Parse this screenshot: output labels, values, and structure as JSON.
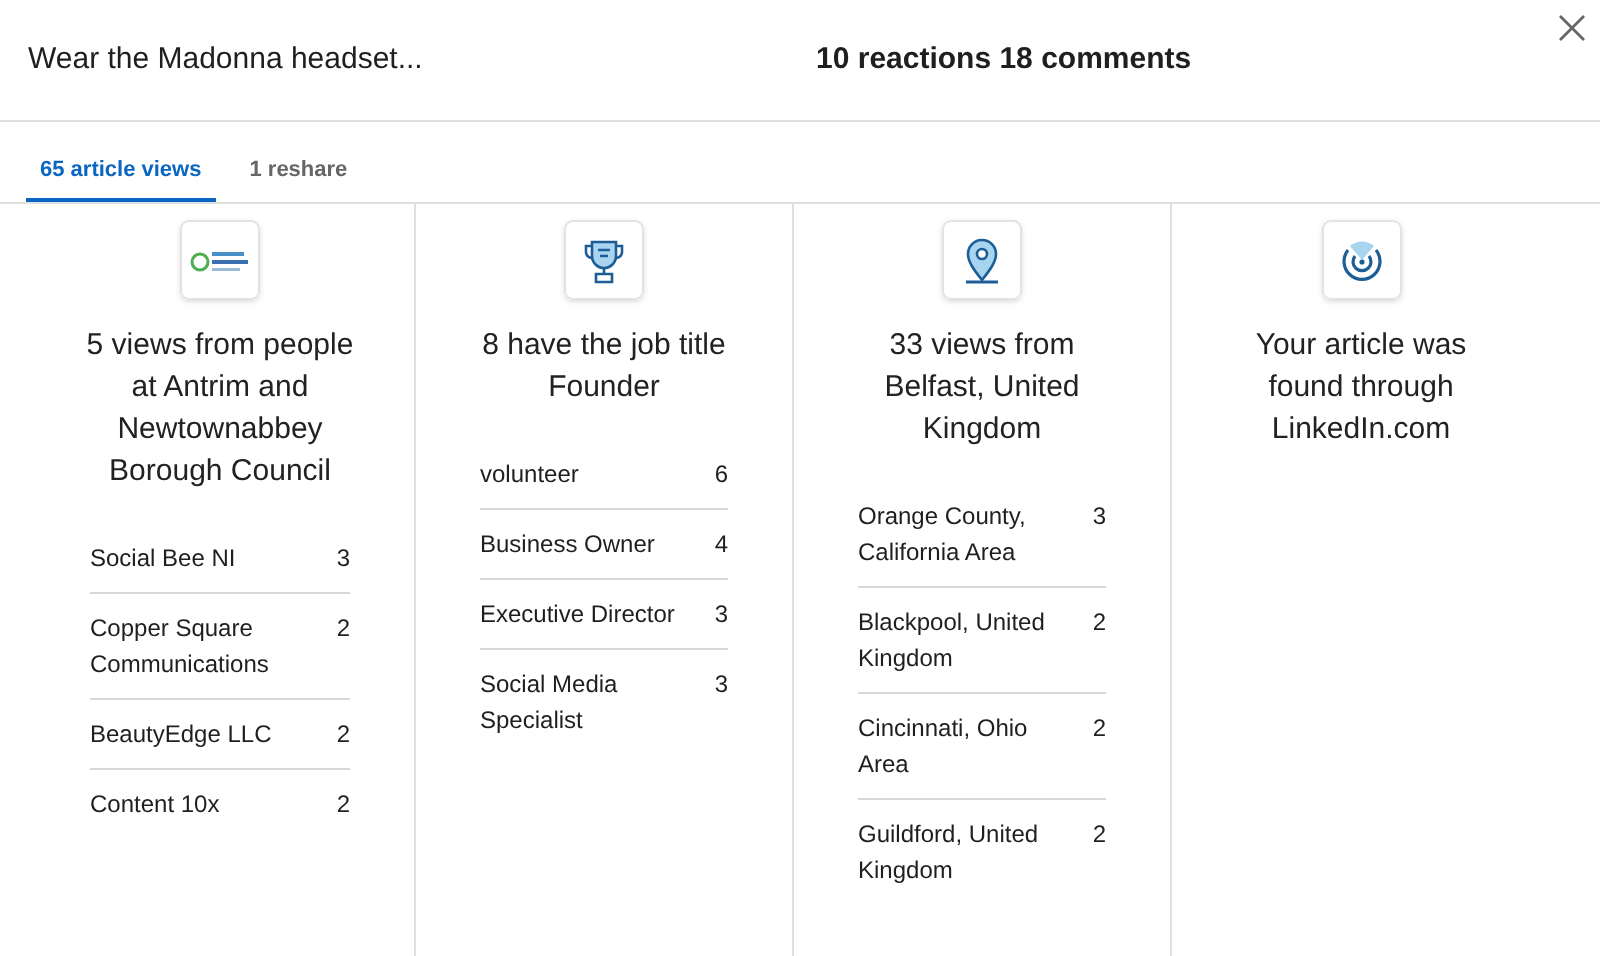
{
  "header": {
    "title": "Wear the Madonna headset...",
    "summary": "10 reactions 18 comments"
  },
  "tabs": [
    {
      "label": "65 article views",
      "selected": true
    },
    {
      "label": "1 reshare",
      "selected": false
    }
  ],
  "columns": [
    {
      "kind": "logo",
      "heading": "5 views from people at Antrim and Newtownabbey Borough Council",
      "rows": [
        {
          "label": "Social Bee NI",
          "count": "3"
        },
        {
          "label": "Copper Square Communications",
          "count": "2"
        },
        {
          "label": "BeautyEdge LLC",
          "count": "2"
        },
        {
          "label": "Content 10x",
          "count": "2"
        }
      ]
    },
    {
      "kind": "trophy",
      "heading": "8 have the job title Founder",
      "rows": [
        {
          "label": "volunteer",
          "count": "6"
        },
        {
          "label": "Business Owner",
          "count": "4"
        },
        {
          "label": "Executive Director",
          "count": "3"
        },
        {
          "label": "Social Media Specialist",
          "count": "3"
        }
      ]
    },
    {
      "kind": "pin",
      "heading": "33 views from Belfast, United Kingdom",
      "rows": [
        {
          "label": "Orange County, California Area",
          "count": "3"
        },
        {
          "label": "Blackpool, United Kingdom",
          "count": "2"
        },
        {
          "label": "Cincinnati, Ohio Area",
          "count": "2"
        },
        {
          "label": "Guildford, United Kingdom",
          "count": "2"
        }
      ]
    },
    {
      "kind": "target",
      "heading": "Your article was found through LinkedIn.com"
    }
  ]
}
